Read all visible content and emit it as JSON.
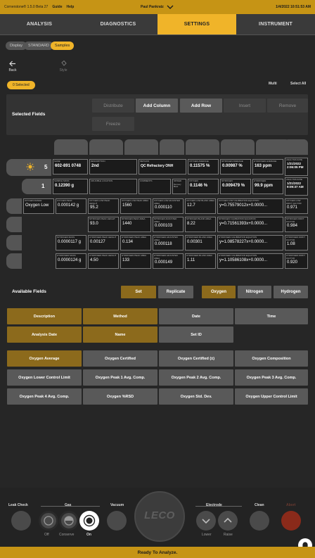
{
  "titlebar": {
    "app": "Cornerstone® 1.5.0 Beta 27",
    "guide": "Guide",
    "help": "Help",
    "user": "Paul Pankratz",
    "datetime": "1/4/2022  10:51:53 AM"
  },
  "nav": {
    "tabs": [
      "ANALYSIS",
      "DIAGNOSTICS",
      "SETTINGS",
      "INSTRUMENT"
    ],
    "active": 2
  },
  "breadcrumb": [
    "Display",
    "STANDARD",
    "Samples"
  ],
  "toolbar": {
    "back": "Back",
    "style": "Style",
    "selected": "0 Selected",
    "multi": "Multi",
    "select_all": "Select All"
  },
  "selected_fields": {
    "label": "Selected Fields",
    "distribute": "Distribute",
    "add_column": "Add Column",
    "add_row": "Add Row",
    "insert": "Insert",
    "remove": "Remove",
    "freeze": "Freeze"
  },
  "grid": {
    "row1": {
      "num": "5",
      "cells": [
        {
          "l": "NAME",
          "v": "602-891 0748"
        },
        {
          "l": "DESCRIPTION",
          "v": "2nd"
        },
        {
          "l": "METHOD",
          "v": "QC Refractory ONH"
        },
        {
          "l": "OXYGEN AVERAGE",
          "v": "0.11575 %"
        },
        {
          "l": "NITROGEN AVERAGE",
          "v": "0.00987 %"
        },
        {
          "l": "HYDROGEN AVERAGE",
          "v": "163 ppm"
        },
        {
          "l": "ANALYSIS DATE",
          "v": "1/21/2022 2:06:05 PM"
        }
      ]
    },
    "row2": {
      "num": "1",
      "cells": [
        {
          "l": "SAMPLE MASS",
          "v": "0.12390 g"
        },
        {
          "l": "CRUCIBLE LOCATION",
          "v": ""
        },
        {
          "l": "COMMENTS",
          "v": ""
        },
        {
          "l": "SPIKED",
          "v": "",
          "extra": "Recovery Blank"
        },
        {
          "l": "OXYGEN",
          "v": "0.1146 %"
        },
        {
          "l": "NITROGEN",
          "v": "0.009479 %"
        },
        {
          "l": "HYDROGEN",
          "v": "99.9 ppm"
        },
        {
          "l": "ANALYSIS DATE",
          "v": "1/21/2022 9:09:37 AM"
        }
      ]
    },
    "row3": [
      {
        "l": "OXYGEN RANGE",
        "v": "Oxygen Low"
      },
      {
        "l": "OXYGEN PEAK",
        "v": "0.000142 g"
      },
      {
        "l": "OXYGEN LOW PEAK HEIGHT",
        "v": "95.2"
      },
      {
        "l": "OXYGEN LOW PEAK AREA",
        "v": "1560"
      },
      {
        "l": "OXYGEN LOW ADJUSTED AREA",
        "v": "0.000110"
      },
      {
        "l": "OXYGEN LOW BLANK AREA",
        "v": "12.7"
      },
      {
        "l": "OXYGEN LOW CALIBRATION EQUATION",
        "v": "y=0.75579012x+0.0000..."
      },
      {
        "l": "OXYGEN LOW DRIFT FACTOR",
        "v": "0.971"
      }
    ],
    "row4": [
      {
        "l": "NITROGEN PEAK HEIGHT",
        "v": "93.0"
      },
      {
        "l": "NITROGEN PEAK AREA",
        "v": "1440"
      },
      {
        "l": "NITROGEN ADJUSTED AREA",
        "v": "0.000103"
      },
      {
        "l": "NITROGEN BLANK AREA",
        "v": "8.22"
      },
      {
        "l": "NITROGEN CALIBRATION EQUATION",
        "v": "y=0.71561393x+0.0000..."
      },
      {
        "l": "NITROGEN DRIFT FACTOR",
        "v": "0.984"
      }
    ],
    "row5": [
      {
        "l": "NITROGEN MASS",
        "v": "0.0000117 g"
      },
      {
        "l": "HYDROGEN PEAK HEIGHT",
        "v": "0.00127"
      },
      {
        "l": "HYDROGEN PEAK AREA",
        "v": "0.134"
      },
      {
        "l": "HYDROGEN ADJUSTED AREA",
        "v": "0.000118"
      },
      {
        "l": "HYDROGEN BLANK AREA",
        "v": "0.00301"
      },
      {
        "l": "HYDROGEN CALIBRATION EQUATION",
        "v": "y=1.08578227x+0.0000..."
      },
      {
        "l": "HYDROGEN DRIFT FACTOR",
        "v": "1.08"
      }
    ],
    "row6": [
      {
        "l": "HYDROGEN MASS",
        "v": "0.0000124 g"
      },
      {
        "l": "HYDROGEN PEAK HEIGHT",
        "v": "4.50"
      },
      {
        "l": "HYDROGEN PEAK AREA",
        "v": "133"
      },
      {
        "l": "HYDROGEN ADJUSTED AREA",
        "v": "0.000149"
      },
      {
        "l": "HYDROGEN BLANK AREA",
        "v": "1.11"
      },
      {
        "l": "HYDROGEN CALIBRATION EQUATION",
        "v": "y=1.10586108x+0.0000..."
      },
      {
        "l": "HYDROGEN DRIFT FACTOR",
        "v": "0.920"
      }
    ]
  },
  "available": {
    "label": "Available Fields",
    "set": "Set",
    "replicate": "Replicate",
    "oxygen": "Oxygen",
    "nitrogen": "Nitrogen",
    "hydrogen": "Hydrogen"
  },
  "fields_general": [
    "Description",
    "Method",
    "Date",
    "Time",
    "Analysis Date",
    "Name",
    "Set ID"
  ],
  "fields_oxygen": [
    "Oxygen Average",
    "Oxygen Certified",
    "Oxygen Certified (±)",
    "Oxygen Composition",
    "Oxygen Lower Control Limit",
    "Oxygen Peak 1 Avg. Comp.",
    "Oxygen Peak 2 Avg. Comp.",
    "Oxygen Peak 3 Avg. Comp.",
    "Oxygen Peak 4 Avg. Comp.",
    "Oxygen %RSD",
    "Oxygen Std. Dev.",
    "Oxygen Upper Control Limit"
  ],
  "footer": {
    "leak_check": "Leak Check",
    "gas": "Gas",
    "off": "Off",
    "conserve": "Conserve",
    "on": "On",
    "vacuum": "Vacuum",
    "logo": "LECO",
    "electrode": "Electrode",
    "lower": "Lower",
    "raise": "Raise",
    "clean": "Clean",
    "abort": "Abort"
  },
  "status": "Ready To Analyze.",
  "colors": {
    "accent": "#f0b429",
    "bar": "#c69415",
    "field_brown": "#8c6a1c",
    "abort": "#8a2a1a"
  }
}
